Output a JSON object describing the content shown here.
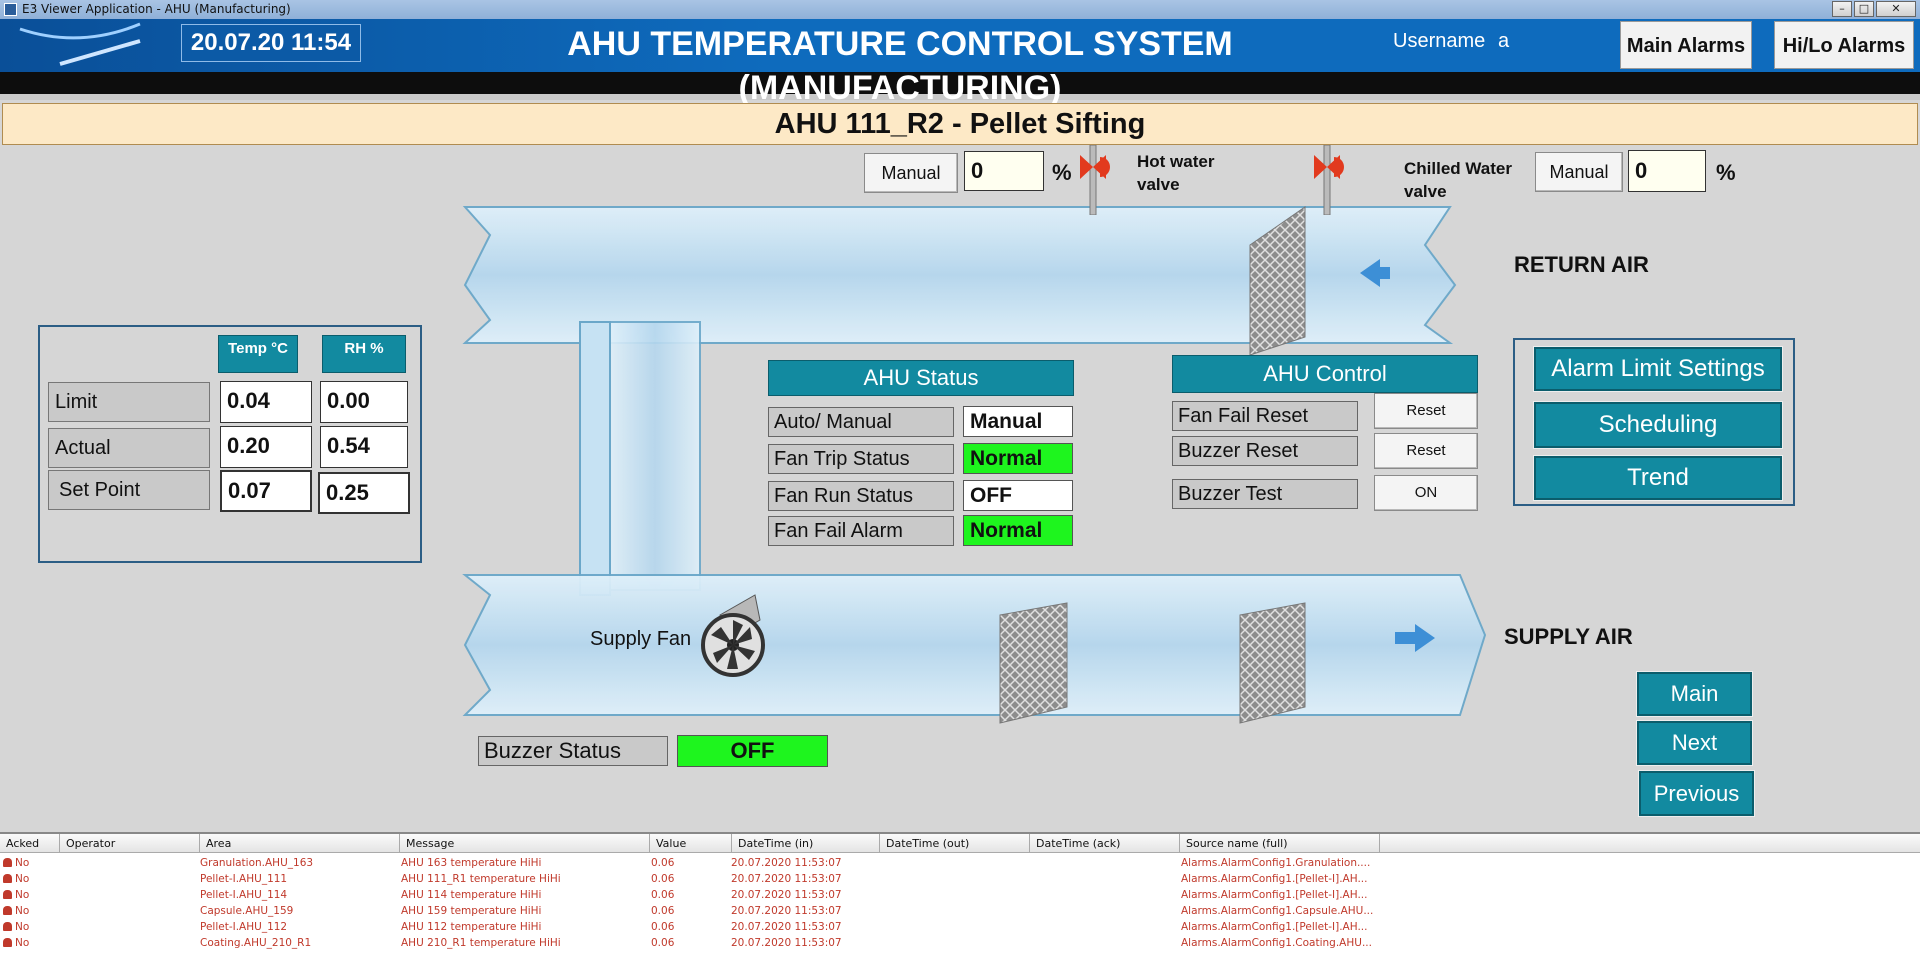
{
  "window": {
    "title": "E3 Viewer Application - AHU  (Manufacturing)",
    "controls": [
      "–",
      "□",
      "✕"
    ]
  },
  "header": {
    "datetime": "20.07.20 11:54",
    "title": "AHU TEMPERATURE CONTROL SYSTEM (MANUFACTURING)",
    "username_label": "Username",
    "username_value": "a",
    "main_alarms_button": "Main Alarms",
    "hilo_alarms_button": "Hi/Lo Alarms"
  },
  "page": {
    "subtitle": "AHU 111_R2  - Pellet  Sifting"
  },
  "valves": {
    "hot_water": {
      "mode": "Manual",
      "value": "0",
      "unit": "%",
      "label": "Hot water valve"
    },
    "chilled_water": {
      "mode": "Manual",
      "value": "0",
      "unit": "%",
      "label": "Chilled Water valve"
    }
  },
  "duct": {
    "return_air": "RETURN AIR",
    "supply_air": "SUPPLY AIR",
    "supply_fan": "Supply Fan"
  },
  "readings": {
    "col_temp": "Temp °C",
    "col_rh": "RH %",
    "rows": [
      {
        "label": "Limit",
        "temp": "0.04",
        "rh": "0.00"
      },
      {
        "label": "Actual",
        "temp": "0.20",
        "rh": "0.54"
      },
      {
        "label": "Set Point",
        "temp": "0.07",
        "rh": "0.25"
      }
    ]
  },
  "ahu_status": {
    "title": "AHU Status",
    "rows": [
      {
        "label": "Auto/ Manual",
        "value": "Manual",
        "state": "white"
      },
      {
        "label": "Fan Trip Status",
        "value": "Normal",
        "state": "green"
      },
      {
        "label": "Fan Run Status",
        "value": "OFF",
        "state": "white"
      },
      {
        "label": "Fan Fail Alarm",
        "value": "Normal",
        "state": "green"
      }
    ]
  },
  "ahu_control": {
    "title": "AHU Control",
    "rows": [
      {
        "label": "Fan Fail Reset",
        "button": "Reset"
      },
      {
        "label": "Buzzer Reset",
        "button": "Reset"
      },
      {
        "label": "Buzzer Test",
        "button": "ON"
      }
    ]
  },
  "side_menu": {
    "alarm_limit_settings": "Alarm Limit Settings",
    "scheduling": "Scheduling",
    "trend": "Trend"
  },
  "nav": {
    "main": "Main",
    "next": "Next",
    "previous": "Previous"
  },
  "buzzer": {
    "label": "Buzzer Status",
    "value": "OFF"
  },
  "alarm_grid": {
    "columns": [
      "Acked",
      "Operator",
      "Area",
      "Message",
      "Value",
      "DateTime (in)",
      "DateTime (out)",
      "DateTime (ack)",
      "Source name (full)"
    ],
    "rows": [
      {
        "acked": "No",
        "operator": "",
        "area": "Granulation.AHU_163",
        "message": "AHU 163 temperature HiHi",
        "value": "0.06",
        "dt_in": "20.07.2020 11:53:07",
        "dt_out": "",
        "dt_ack": "",
        "source": "Alarms.AlarmConfig1.Granulation...."
      },
      {
        "acked": "No",
        "operator": "",
        "area": "Pellet-I.AHU_111",
        "message": "AHU 111_R1 temperature HiHi",
        "value": "0.06",
        "dt_in": "20.07.2020 11:53:07",
        "dt_out": "",
        "dt_ack": "",
        "source": "Alarms.AlarmConfig1.[Pellet-I].AH..."
      },
      {
        "acked": "No",
        "operator": "",
        "area": "Pellet-I.AHU_114",
        "message": "AHU 114 temperature HiHi",
        "value": "0.06",
        "dt_in": "20.07.2020 11:53:07",
        "dt_out": "",
        "dt_ack": "",
        "source": "Alarms.AlarmConfig1.[Pellet-I].AH..."
      },
      {
        "acked": "No",
        "operator": "",
        "area": "Capsule.AHU_159",
        "message": "AHU 159 temperature HiHi",
        "value": "0.06",
        "dt_in": "20.07.2020 11:53:07",
        "dt_out": "",
        "dt_ack": "",
        "source": "Alarms.AlarmConfig1.Capsule.AHU..."
      },
      {
        "acked": "No",
        "operator": "",
        "area": "Pellet-I.AHU_112",
        "message": "AHU 112 temperature HiHi",
        "value": "0.06",
        "dt_in": "20.07.2020 11:53:07",
        "dt_out": "",
        "dt_ack": "",
        "source": "Alarms.AlarmConfig1.[Pellet-I].AH..."
      },
      {
        "acked": "No",
        "operator": "",
        "area": "Coating.AHU_210_R1",
        "message": "AHU 210_R1 temperature HiHi",
        "value": "0.06",
        "dt_in": "20.07.2020 11:53:07",
        "dt_out": "",
        "dt_ack": "",
        "source": "Alarms.AlarmConfig1.Coating.AHU..."
      }
    ]
  },
  "colors": {
    "header_blue": "#0e6bbd",
    "teal_button": "#128aa0",
    "status_green": "#1ef51e",
    "alarm_red": "#c0392b",
    "subtitle_bg": "#fde9c6"
  }
}
